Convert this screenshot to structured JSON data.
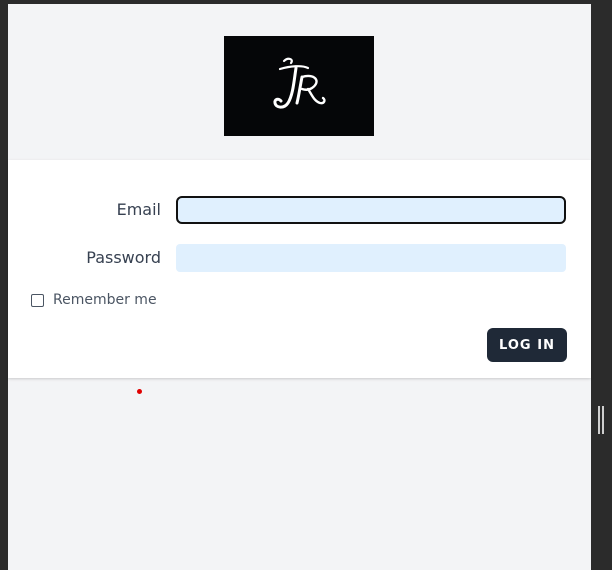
{
  "logo": {
    "text": "JR",
    "icon": "jr-monogram-logo",
    "background": "#050608",
    "color": "#ffffff"
  },
  "form": {
    "email_label": "Email",
    "email_value": "",
    "password_label": "Password",
    "password_value": "",
    "remember_label": "Remember me",
    "remember_checked": false,
    "submit_label": "LOG IN"
  },
  "colors": {
    "page_bg": "#f3f4f6",
    "card_bg": "#ffffff",
    "input_bg": "#e0f0fe",
    "button_bg": "#1f2937",
    "frame": "#2b2b2b",
    "cursor_dot": "#e00000"
  }
}
